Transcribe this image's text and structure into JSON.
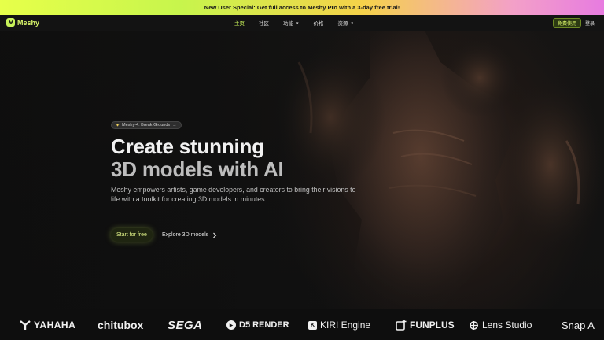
{
  "promo": {
    "text": "New User Special: Get full access to Meshy Pro with a 3-day free trial!"
  },
  "header": {
    "logo_text": "Meshy",
    "nav": [
      {
        "label": "主页",
        "active": true,
        "has_caret": false
      },
      {
        "label": "社区",
        "active": false,
        "has_caret": false
      },
      {
        "label": "功能",
        "active": false,
        "has_caret": true
      },
      {
        "label": "价格",
        "active": false,
        "has_caret": false
      },
      {
        "label": "资源",
        "active": false,
        "has_caret": true
      }
    ],
    "free_button": "免费使用",
    "login_button": "登录"
  },
  "hero": {
    "badge": "Meshy-4: Break Grounds",
    "headline_line1": "Create stunning",
    "headline_line2": "3D models with AI",
    "subtext": "Meshy empowers artists, game developers, and creators to bring their visions to life with a toolkit for creating 3D models in minutes.",
    "start_button": "Start for free",
    "explore_button": "Explore 3D models"
  },
  "partners": {
    "yahaha": "YAHAHA",
    "chitubox": "chitubox",
    "sega": "SEGA",
    "d5": "D5 RENDER",
    "kiri": "KIRI Engine",
    "funplus": "FUNPLUS",
    "lens": "Lens Studio",
    "snap": "Snap A"
  },
  "colors": {
    "accent": "#c8f25a",
    "background": "#0e0e0e"
  },
  "icons": [
    "meshy-logo-icon",
    "chevron-down-icon",
    "sparkle-icon",
    "arrow-right-icon",
    "chevron-right-icon"
  ]
}
